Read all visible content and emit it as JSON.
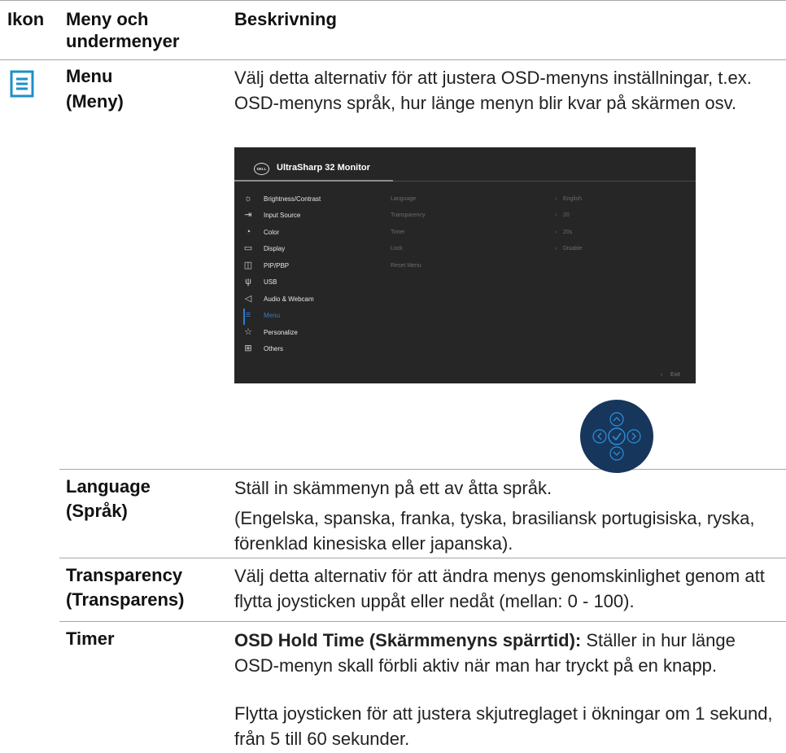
{
  "header": {
    "col_icon": "Ikon",
    "col_menu": "Meny och undermenyer",
    "col_desc": "Beskrivning"
  },
  "menu_row": {
    "icon": "list-document-icon",
    "title": "Menu",
    "title_sv": "(Meny)",
    "desc": "Välj detta alternativ för att justera OSD-menyns inställningar, t.ex. OSD-menyns språk, hur länge menyn blir kvar på skärmen osv."
  },
  "osd": {
    "brand": "DELL",
    "title": "UltraSharp 32 Monitor",
    "menu_items": [
      {
        "label": "Brightness/Contrast",
        "icon": "sun-icon"
      },
      {
        "label": "Input Source",
        "icon": "input-icon"
      },
      {
        "label": "Color",
        "icon": "palette-icon"
      },
      {
        "label": "Display",
        "icon": "monitor-icon"
      },
      {
        "label": "PIP/PBP",
        "icon": "pip-icon"
      },
      {
        "label": "USB",
        "icon": "usb-icon"
      },
      {
        "label": "Audio & Webcam",
        "icon": "speaker-icon"
      },
      {
        "label": "Menu",
        "icon": "menu-icon"
      },
      {
        "label": "Personalize",
        "icon": "star-icon"
      },
      {
        "label": "Others",
        "icon": "others-icon"
      }
    ],
    "options": [
      {
        "label": "Language",
        "value": "English"
      },
      {
        "label": "Transparency",
        "value": "20"
      },
      {
        "label": "Timer",
        "value": "20s"
      },
      {
        "label": "Lock",
        "value": "Disable"
      },
      {
        "label": "Reset Menu",
        "value": ""
      }
    ],
    "exit": "Exit"
  },
  "rows": [
    {
      "label1": "Language",
      "label2": "(Språk)",
      "desc1": "Ställ in skämmenyn på ett av åtta språk.",
      "desc2": "(Engelska, spanska, franka, tyska, brasiliansk portugisiska, ryska, förenklad kinesiska eller japanska)."
    },
    {
      "label1": "Transparency",
      "label2": "(Transparens)",
      "desc1": "Välj detta alternativ för att ändra menys genomskinlighet genom att flytta joysticken uppåt eller nedåt (mellan: 0 - 100)."
    },
    {
      "label1": "Timer",
      "desc_bold": "OSD Hold Time (Skärmmenyns spärrtid):",
      "desc1": " Ställer in hur länge OSD-menyn skall förbli aktiv när man har tryckt på en knapp.",
      "desc2": "Flytta joysticken för att justera skjutreglaget i ökningar om 1 sekund, från 5 till 60 sekunder."
    }
  ]
}
